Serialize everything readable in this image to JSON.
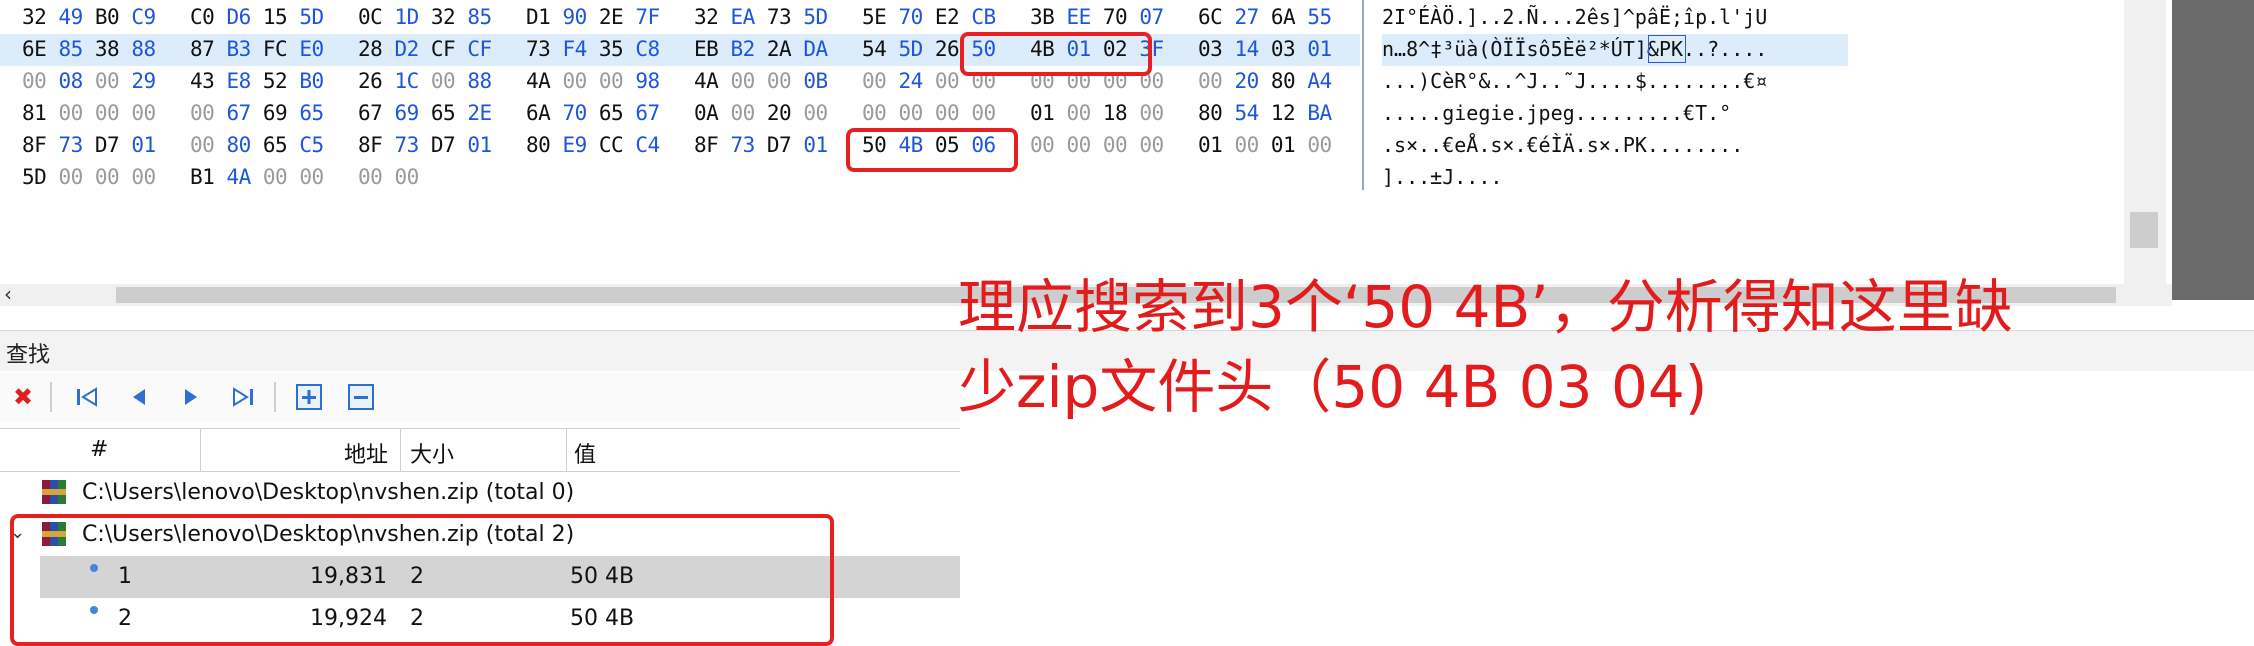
{
  "hex_rows": [
    {
      "cells": [
        "32 49 B0 C9",
        "C0 D6 15 5D",
        "0C 1D 32 85",
        "D1 90 2E 7F",
        "32 EA 73 5D",
        "5E 70 E2 CB",
        "3B EE 70 07",
        "6C 27 6A 55"
      ],
      "ascii": "2I°ÉÀÖ.]..2.Ñ...2ês]^pâË;îp.l'jU"
    },
    {
      "cells": [
        "6E 85 38 88",
        "87 B3 FC E0",
        "28 D2 CF CF",
        "73 F4 35 C8",
        "EB B2 2A DA",
        "54 5D 26 50",
        "4B 01 02 3F",
        "03 14 03 01"
      ],
      "ascii": "n…8^‡³üà(ÒÏÏsô5Èë²*ÚT]&PK..?...."
    },
    {
      "cells": [
        "00 08 00 29",
        "43 E8 52 B0",
        "26 1C 00 88",
        "4A 00 00 98",
        "4A 00 00 0B",
        "00 24 00 00",
        "00 00 00 00",
        "00 20 80 A4"
      ],
      "ascii": "...)CèR°&..^J..˜J....$........€¤"
    },
    {
      "cells": [
        "81 00 00 00",
        "00 67 69 65",
        "67 69 65 2E",
        "6A 70 65 67",
        "0A 00 20 00",
        "00 00 00 00",
        "01 00 18 00",
        "80 54 12 BA"
      ],
      "ascii": ".....giegie.jpeg.........€T.°"
    },
    {
      "cells": [
        "8F 73 D7 01",
        "00 80 65 C5",
        "8F 73 D7 01",
        "80 E9 CC C4",
        "8F 73 D7 01",
        "50 4B 05 06",
        "00 00 00 00",
        "01 00 01 00"
      ],
      "ascii": ".s×..€eÅ.s×.€éÌÄ.s×.PK........"
    },
    {
      "cells": [
        "5D 00 00 00",
        "B1 4A 00 00",
        "00 00",
        "",
        "",
        "",
        "",
        ""
      ],
      "ascii": "]...±J...."
    }
  ],
  "find_panel": {
    "title": "查找"
  },
  "toolbar": {
    "buttons": [
      "close-icon",
      "first-icon",
      "prev-icon",
      "next-icon",
      "last-icon",
      "expand-icon",
      "collapse-icon"
    ]
  },
  "results": {
    "headers": [
      "#",
      "地址",
      "大小",
      "值"
    ],
    "rows": [
      {
        "label": "C:\\Users\\lenovo\\Desktop\\nvshen.zip (total 0)"
      },
      {
        "label": "C:\\Users\\lenovo\\Desktop\\nvshen.zip (total 2)"
      },
      {
        "index": "1",
        "address": "19,831",
        "size": "2",
        "value": "50 4B"
      },
      {
        "index": "2",
        "address": "19,924",
        "size": "2",
        "value": "50 4B"
      }
    ]
  },
  "annotation": {
    "line1": "理应搜索到3个‘50 4B’，分析得知这里缺",
    "line2": "少zip文件头（50 4B 03 04)"
  },
  "colors": {
    "accent_red": "#e21c1c",
    "hex_blue": "#1e56d8",
    "selection": "#dcecfa"
  }
}
